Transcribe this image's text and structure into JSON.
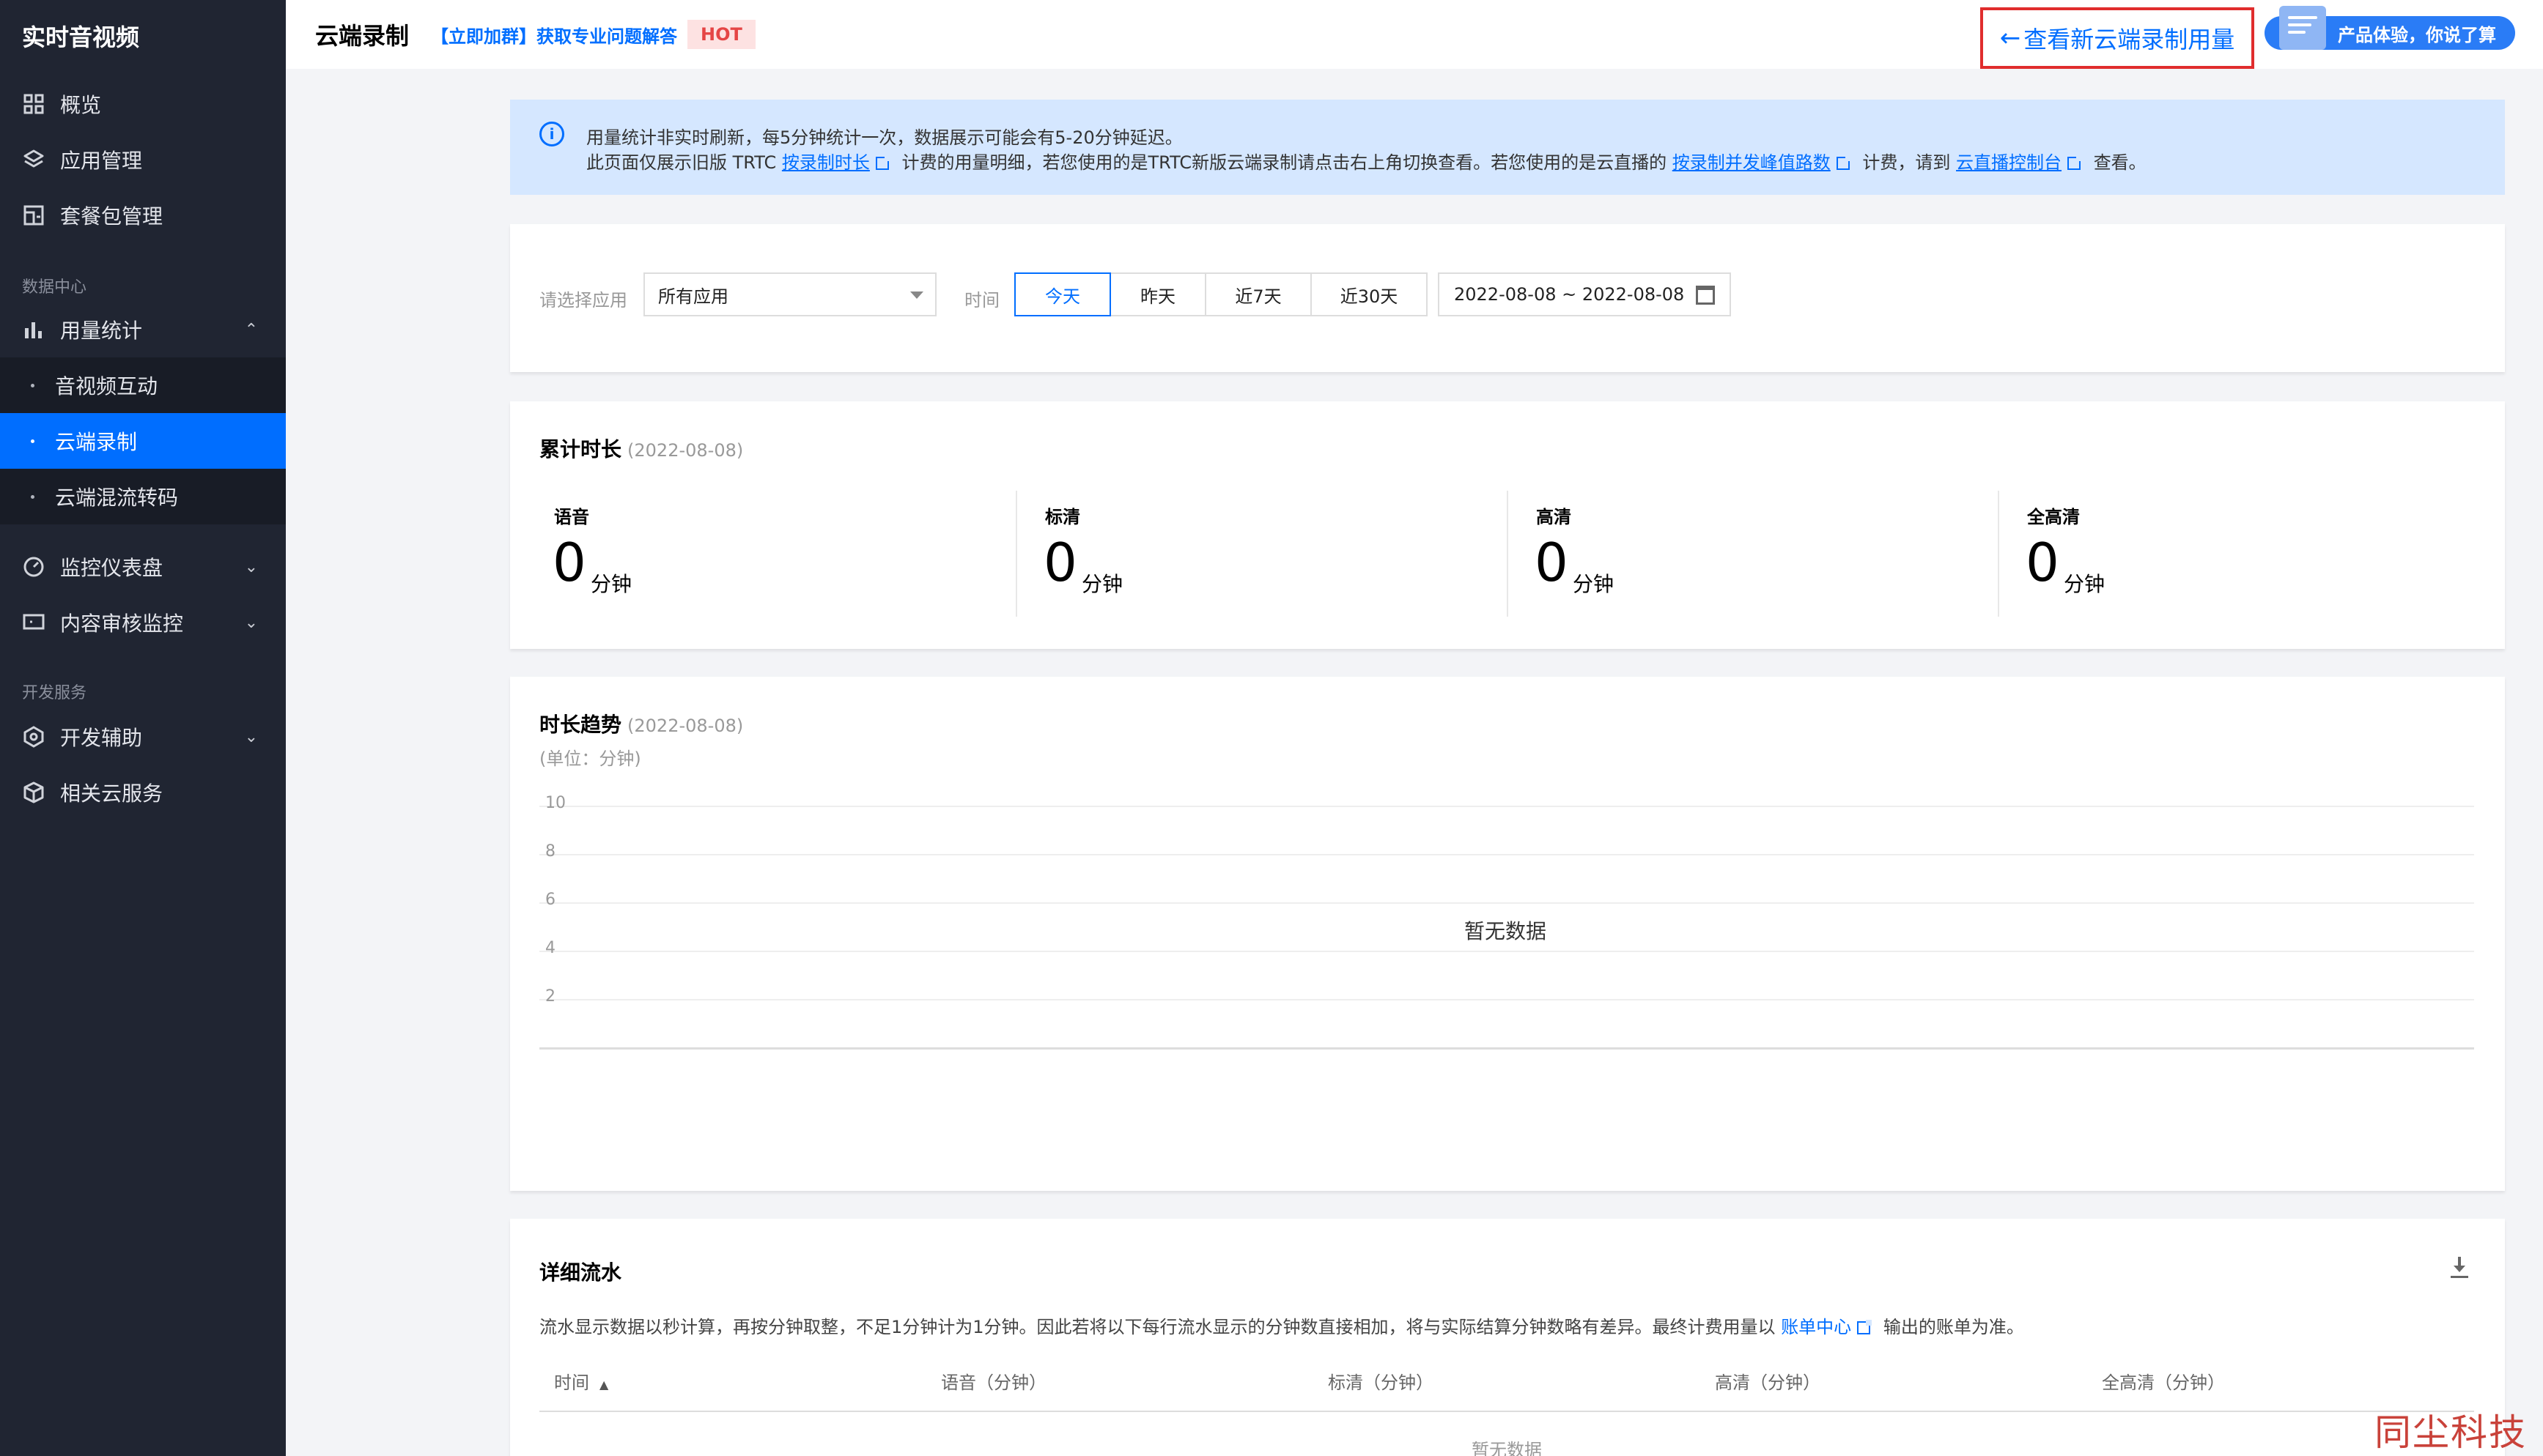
{
  "sidebar": {
    "product_title": "实时音视频",
    "items_top": [
      {
        "label": "概览",
        "icon": "grid-icon"
      },
      {
        "label": "应用管理",
        "icon": "layers-icon"
      },
      {
        "label": "套餐包管理",
        "icon": "package-icon"
      }
    ],
    "group_data": "数据中心",
    "usage_stats": {
      "label": "用量统计",
      "icon": "bar-chart-icon",
      "expanded": true
    },
    "usage_sub": [
      {
        "label": "音视频互动",
        "active": false
      },
      {
        "label": "云端录制",
        "active": true
      },
      {
        "label": "云端混流转码",
        "active": false
      }
    ],
    "monitor_dashboard": {
      "label": "监控仪表盘",
      "icon": "gauge-icon"
    },
    "content_review": {
      "label": "内容审核监控",
      "icon": "monitor-icon"
    },
    "group_dev": "开发服务",
    "dev_assist": {
      "label": "开发辅助",
      "icon": "hexagon-icon"
    },
    "related_cloud": {
      "label": "相关云服务",
      "icon": "cube-icon"
    }
  },
  "header": {
    "title": "云端录制",
    "join_link": "【立即加群】获取专业问题解答",
    "hot_badge": "HOT",
    "new_usage_link": "查看新云端录制用量",
    "feedback_pill": "产品体验，你说了算"
  },
  "notice": {
    "line1": "用量统计非实时刷新，每5分钟统计一次，数据展示可能会有5-20分钟延迟。",
    "line2_a": "此页面仅展示旧版 TRTC",
    "line2_link1": "按录制时长",
    "line2_b": "计费的用量明细，若您使用的是TRTC新版云端录制请点击右上角切换查看。若您使用的是云直播的",
    "line2_link2": "按录制并发峰值路数",
    "line2_c": "计费，请到",
    "line2_link3": "云直播控制台",
    "line2_d": "查看。"
  },
  "filter": {
    "app_label": "请选择应用",
    "app_value": "所有应用",
    "time_label": "时间",
    "time_options": [
      "今天",
      "昨天",
      "近7天",
      "近30天"
    ],
    "selected_time": "今天",
    "date_range": "2022-08-08 ~ 2022-08-08"
  },
  "totals": {
    "title": "累计时长",
    "date": "(2022-08-08)",
    "stats": [
      {
        "name": "语音",
        "value": "0",
        "unit": "分钟"
      },
      {
        "name": "标清",
        "value": "0",
        "unit": "分钟"
      },
      {
        "name": "高清",
        "value": "0",
        "unit": "分钟"
      },
      {
        "name": "全高清",
        "value": "0",
        "unit": "分钟"
      }
    ]
  },
  "trend": {
    "title": "时长趋势",
    "date": "(2022-08-08)",
    "unit": "(单位：分钟)",
    "no_data": "暂无数据"
  },
  "chart_data": {
    "type": "line",
    "title": "时长趋势",
    "ylabel": "(单位：分钟)",
    "y_ticks": [
      "10",
      "8",
      "6",
      "4",
      "2"
    ],
    "ylim": [
      0,
      10
    ],
    "series": [],
    "grid": true
  },
  "detail": {
    "title": "详细流水",
    "desc_a": "流水显示数据以秒计算，再按分钟取整，不足1分钟计为1分钟。因此若将以下每行流水显示的分钟数直接相加，将与实际结算分钟数略有差异。最终计费用量以",
    "desc_link": "账单中心",
    "desc_b": "输出的账单为准。",
    "columns": [
      "时间",
      "语音（分钟）",
      "标清（分钟）",
      "高清（分钟）",
      "全高清（分钟）"
    ],
    "empty_text": "暂无数据"
  },
  "watermark": "同尘科技",
  "colors": {
    "accent": "#006eff",
    "sidebar_bg": "#202532",
    "active_item": "#006eff",
    "highlight_border": "#e02d2d",
    "hot_text": "#e54545"
  }
}
